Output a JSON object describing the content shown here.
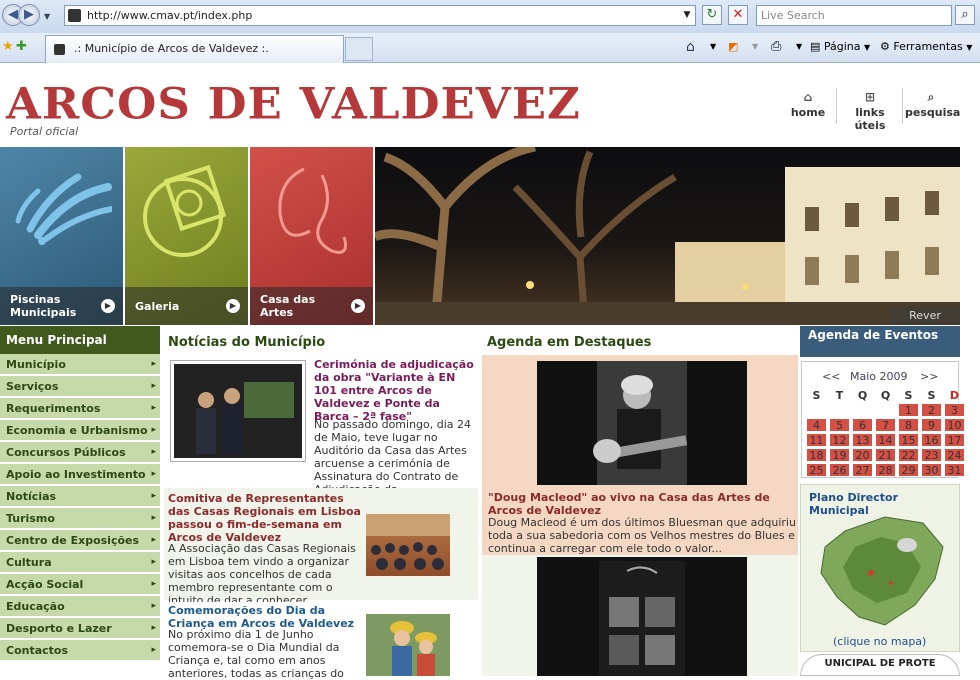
{
  "browser": {
    "url": "http://www.cmav.pt/index.php",
    "search_placeholder": "Live Search",
    "tab_title": ".: Município de Arcos de Valdevez :.",
    "tools": {
      "page": "Página",
      "tools": "Ferramentas"
    }
  },
  "header": {
    "logo": "ARCOS DE VALDEVEZ",
    "subtitle": "Portal oficial",
    "nav": [
      {
        "label": "home",
        "icon": "home-icon"
      },
      {
        "label": "links úteis",
        "icon": "links-icon"
      },
      {
        "label": "pesquisa",
        "icon": "search-icon"
      }
    ]
  },
  "tiles": [
    {
      "label": "Piscinas Municipais",
      "color": "#3d6d8e"
    },
    {
      "label": "Galeria",
      "color": "#8b9b2a"
    },
    {
      "label": "Casa das Artes",
      "color": "#c23f3c"
    }
  ],
  "hero": {
    "caption": "Rever"
  },
  "menu": {
    "title": "Menu Principal",
    "items": [
      "Município",
      "Serviços",
      "Requerimentos",
      "Economia e Urbanismo",
      "Concursos Públicos",
      "Apoio ao Investimento",
      "Notícias",
      "Turismo",
      "Centro de Exposições",
      "Cultura",
      "Acção Social",
      "Educação",
      "Desporto e Lazer",
      "Contactos"
    ]
  },
  "news": {
    "title": "Notícias do Município",
    "items": [
      {
        "headline": "Cerimónia de adjudicação da obra \"Variante à EN 101 entre Arcos de Valdevez e Ponte da Barca – 2ª fase\"",
        "body": "No passado domingo, dia 24 de Maio, teve lugar no Auditório da Casa das Artes arcuense a cerimónia de Assinatura do Contrato de Adjudicação da..."
      },
      {
        "headline": "Comitiva de Representantes das Casas Regionais em Lisboa passou o fim-de-semana em Arcos de Valdevez",
        "body": "A Associação das Casas Regionais em Lisboa tem vindo a organizar visitas aos concelhos de cada membro representante com o intuito de dar a conhecer.."
      },
      {
        "headline": "Comemorações do Dia da Criança em Arcos de Valdevez",
        "body": "No próximo dia 1 de Junho comemora-se o Dia Mundial da Criança e, tal como em anos anteriores, todas as crianças do"
      }
    ]
  },
  "agenda": {
    "title": "Agenda em Destaques",
    "items": [
      {
        "headline": "\"Doug Macleod\" ao vivo na Casa das Artes de Arcos de Valdevez",
        "body": "Doug Macleod é um dos últimos Bluesman que adquiriu toda a sua sabedoria com os Velhos mestres do Blues e continua a carregar com ele todo o valor..."
      }
    ]
  },
  "events": {
    "title": "Agenda de Eventos",
    "prev": "<<",
    "month": "Maio 2009",
    "next": ">>",
    "weekdays": [
      "S",
      "T",
      "Q",
      "Q",
      "S",
      "S",
      "D"
    ],
    "days": [
      "",
      "",
      "",
      "",
      "1",
      "2",
      "3",
      "4",
      "5",
      "6",
      "7",
      "8",
      "9",
      "10",
      "11",
      "12",
      "13",
      "14",
      "15",
      "16",
      "17",
      "18",
      "19",
      "20",
      "21",
      "22",
      "23",
      "24",
      "25",
      "26",
      "27",
      "28",
      "29",
      "30",
      "31"
    ]
  },
  "plan": {
    "title": "Plano Director Municipal",
    "caption": "(clique no mapa)"
  },
  "footer_badge": "UNICIPAL DE PROTE"
}
